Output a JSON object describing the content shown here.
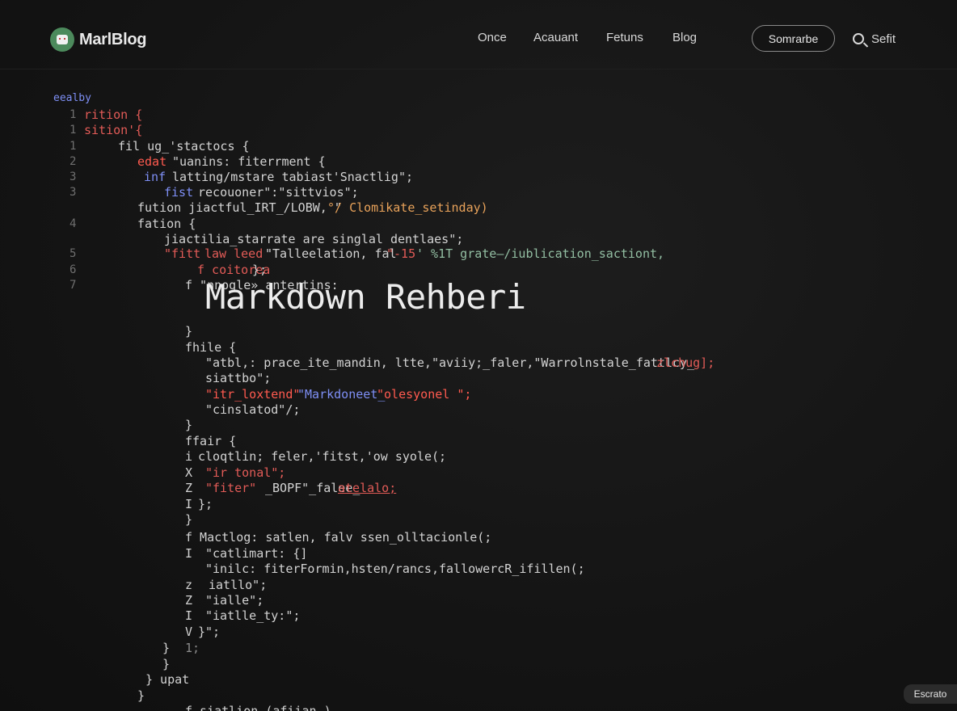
{
  "header": {
    "brand": "MarlBlog",
    "nav": [
      "Once",
      "Acauant",
      "Fetuns",
      "Blog"
    ],
    "button_label": "Somrarbe",
    "search_label": "Sefit"
  },
  "editor": {
    "file_label": "eealby",
    "headline": "Markdown Rehberi",
    "gutter": [
      "1",
      "1",
      "1",
      "2",
      "3",
      "3",
      "4",
      "6",
      "5",
      "6",
      "7"
    ],
    "side_markers": [
      "i",
      "X",
      "Z",
      "I",
      "I",
      "z",
      "Z",
      "I",
      "V"
    ],
    "lines": [
      "rition {",
      "sition'{",
      "fil ug_'stactocs {",
      "edat",
      "\"uanins: fiterrment {",
      "inf",
      "latting/mstare tabiast'Snactlig\";",
      "fist",
      "recouoner\":\"sittvios\";",
      "fution jiactful_IRT_/LOBW, \"",
      "°/ Clomikate_setinday)",
      "fation {",
      "jiactilia_starrate are singlal dentlaes\";",
      "\"fitt",
      "law leed",
      "\"Talleelation, fal",
      "\"-15",
      "' %1T grate—/iublication_sactiont,",
      "f coitorea",
      "};",
      "f \"nnogle» antertins:",
      "}",
      "fhile {",
      "\"atbl,: prace_ite_mandin, ltte,\"aviiy;_faler,\"Warrolnstale_fattlcy_",
      "zlchug];",
      "siattbo\";",
      "\"itr_loxtend\"",
      "\"Markdoneet_",
      "\"olesyonel \";",
      "\"cinslatod\"/;",
      "}",
      "ffair {",
      "cloqtlin; feler,'fitst,'ow syole(;",
      "\"ir tonal\";",
      "\"fiter\"",
      "_BOPF\"_falee_",
      "atelalo;",
      "};",
      "}",
      "f Mactlog: satlen, falv ssen_olltacionle(;",
      "\"catlimart: {]",
      "\"inilc: fiterFormin,hsten/rancs,fallowercR_ifillen(;",
      "iatllo\";",
      "\"ialle\";",
      "\"iatlle_ty:\";",
      "}\";",
      "}",
      "1;",
      "}",
      "} upat",
      "}",
      "f siatlion (afiian )"
    ]
  },
  "toast": "Escrato"
}
